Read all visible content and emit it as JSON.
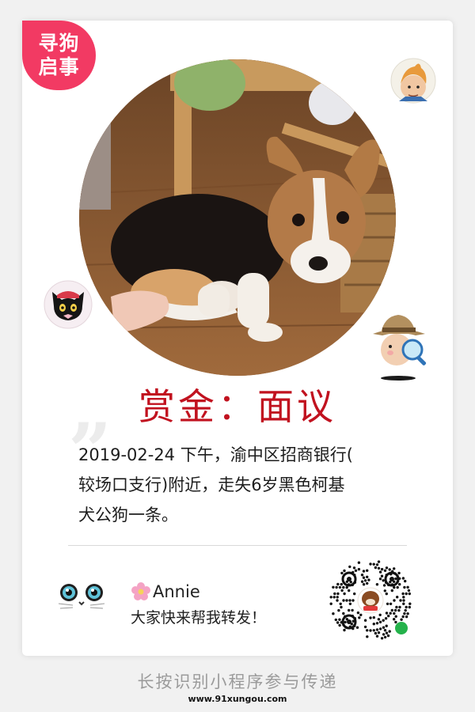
{
  "badge": {
    "line1": "寻狗",
    "line2": "启事"
  },
  "reward": {
    "text": "赏金：面议"
  },
  "description": {
    "lines": [
      "2019-02-24 下午，渝中区招商银行(",
      "较场口支行)附近，走失6岁黑色柯基",
      "犬公狗一条。"
    ]
  },
  "poster": {
    "name": "Annie",
    "message": "大家快来帮我转发！"
  },
  "footer": {
    "hint": "长按识别小程序参与传递",
    "site": "www.91xungou.com"
  },
  "colors": {
    "badge": "#f23a63",
    "reward": "#c1121f",
    "qr_logo_accent": "#24b24b"
  },
  "icons": [
    "tintin-avatar-icon",
    "cat-avatar-icon",
    "detective-icon",
    "cat-face-icon",
    "flower-icon",
    "qr-code",
    "mini-program-icon"
  ]
}
